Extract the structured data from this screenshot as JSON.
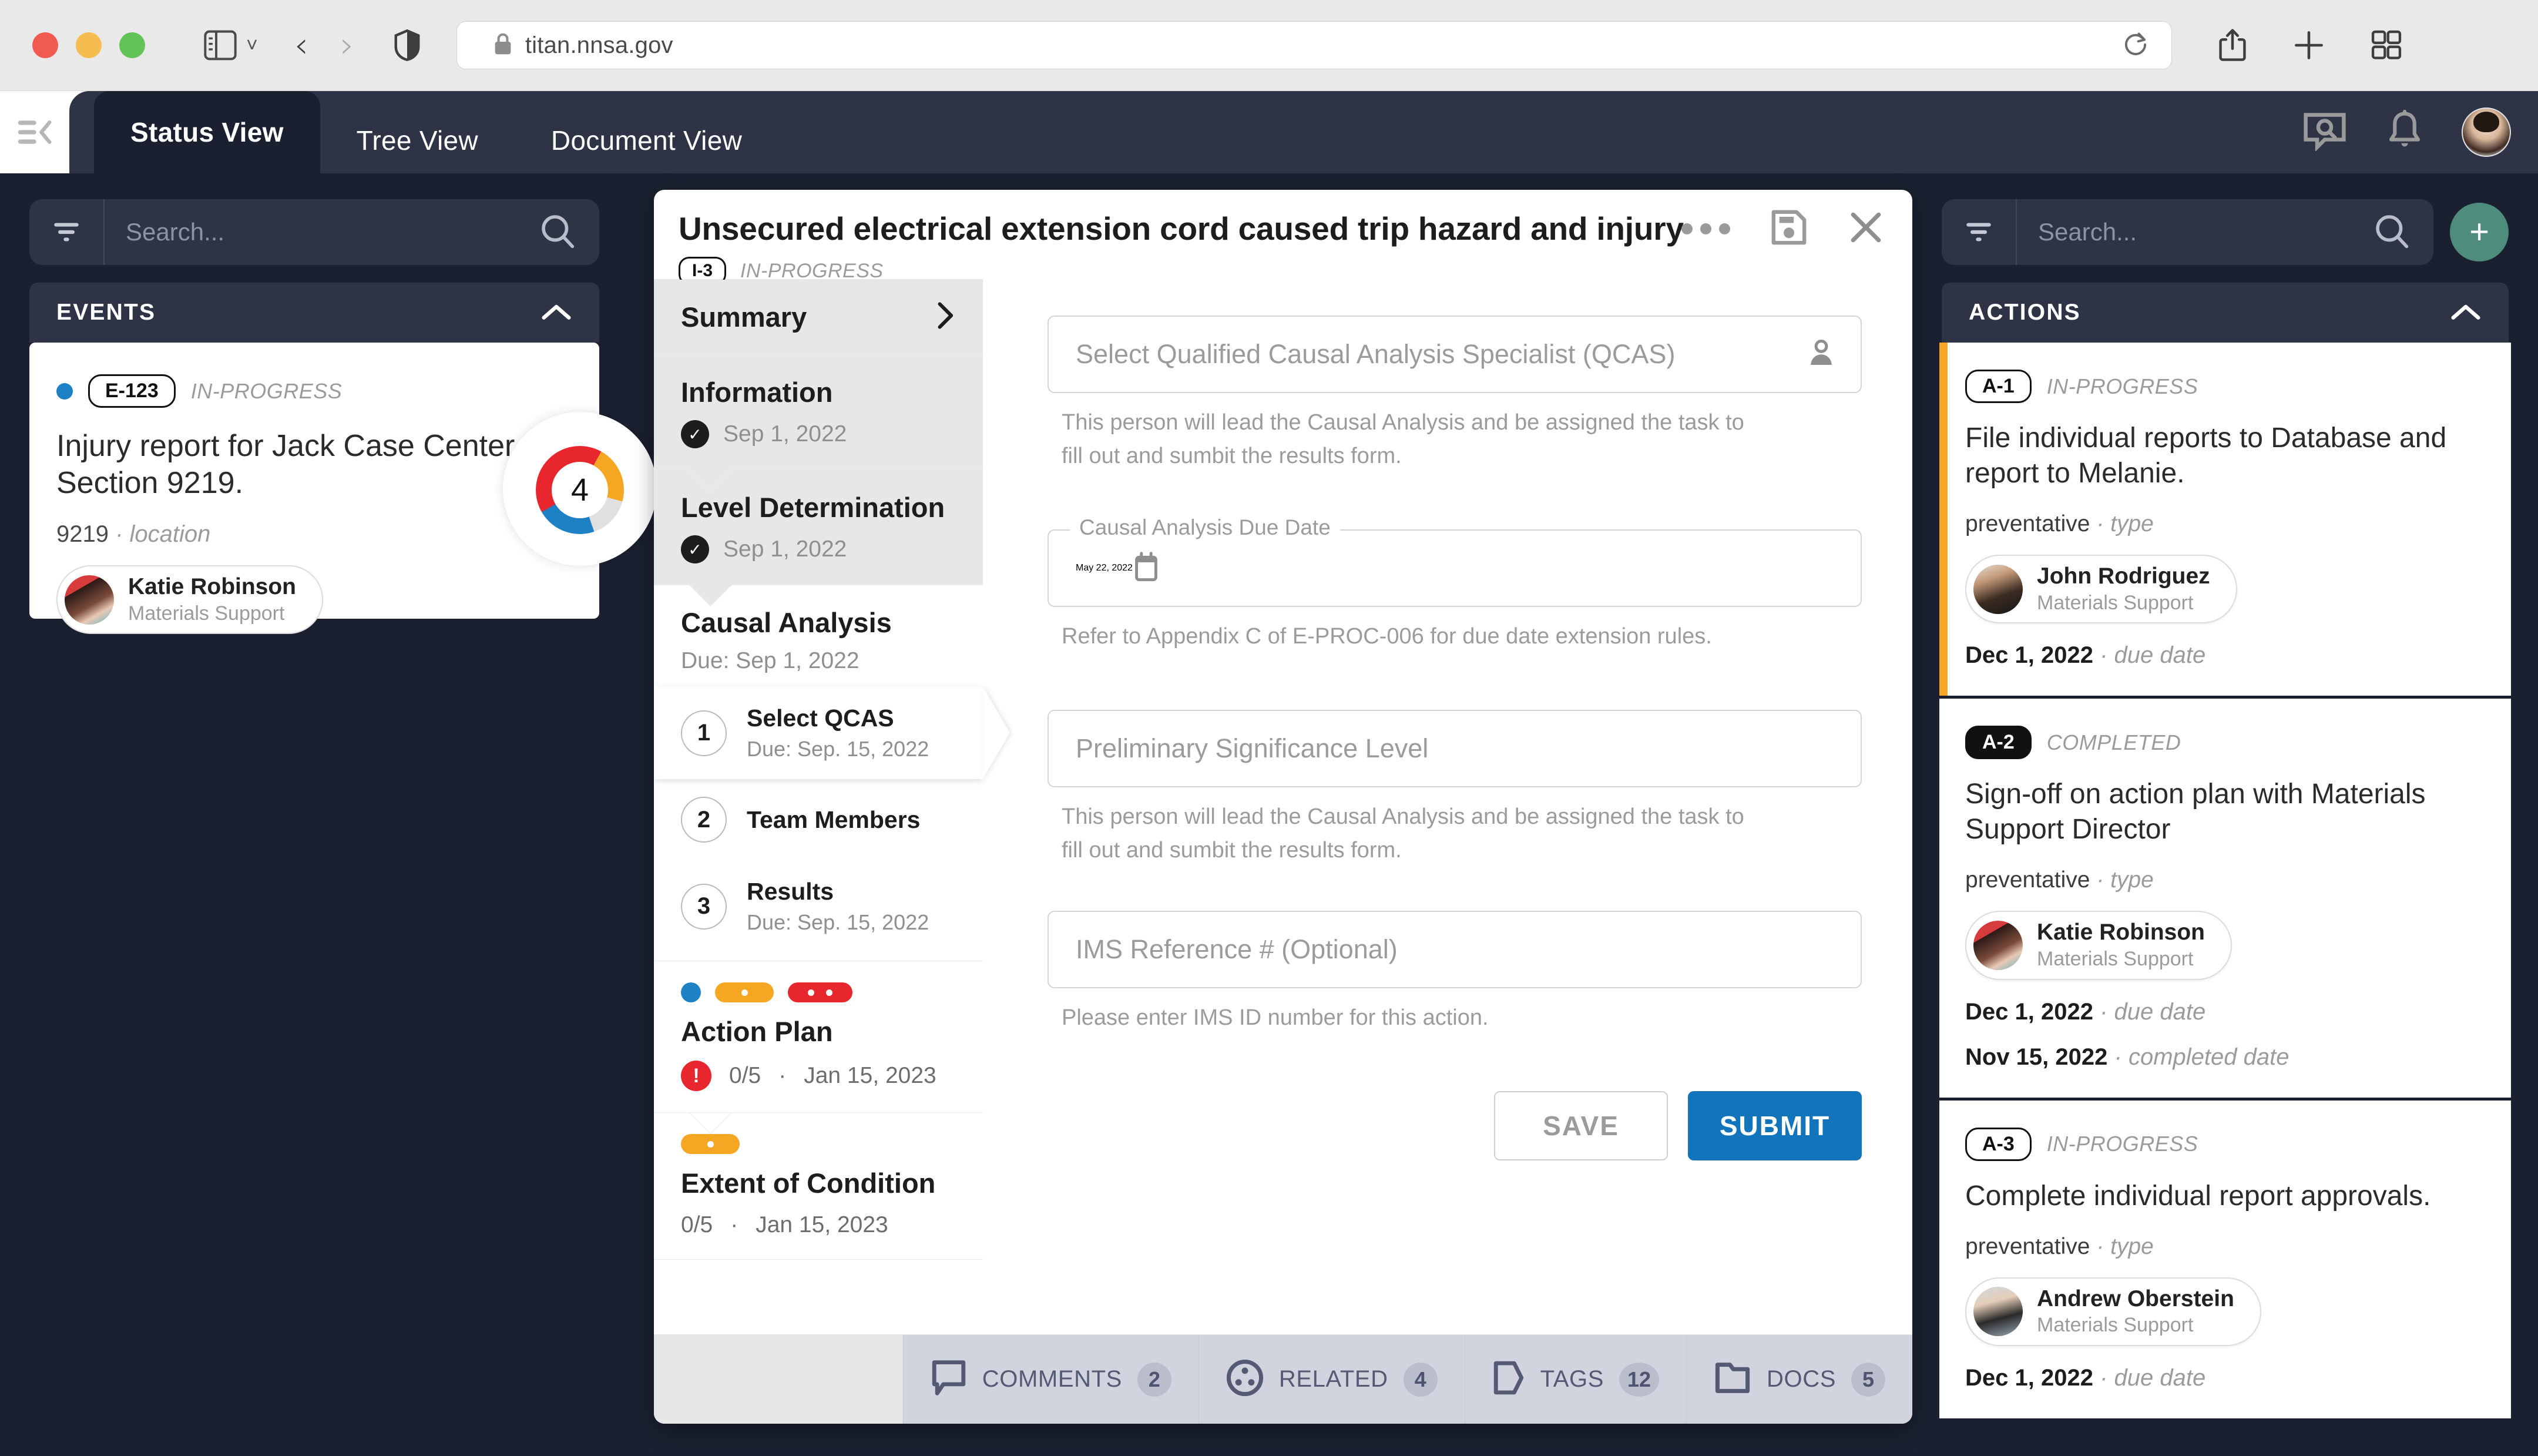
{
  "browser": {
    "url": "titan.nnsa.gov",
    "icons": {
      "sidebar": "sidebar-icon",
      "back": "back-arrow-icon",
      "forward": "forward-arrow-icon",
      "shield": "shield-icon",
      "lock": "lock-icon",
      "reload": "reload-icon",
      "share": "share-icon",
      "new_tab": "plus-icon",
      "tab_overview": "grid-icon"
    }
  },
  "appbar": {
    "tabs": [
      {
        "label": "Status View",
        "active": true
      },
      {
        "label": "Tree View",
        "active": false
      },
      {
        "label": "Document View",
        "active": false
      }
    ]
  },
  "left_panel": {
    "search": {
      "placeholder": "Search..."
    },
    "section": {
      "title": "EVENTS"
    },
    "event": {
      "id": "E-123",
      "status": "IN-PROGRESS",
      "title": "Injury report for Jack Case Center, Section 9219.",
      "number": "9219",
      "number_label": "location",
      "person": {
        "name": "Katie Robinson",
        "role": "Materials Support"
      },
      "donut_value": "4"
    }
  },
  "center": {
    "title": "Unsecured electrical extension cord caused trip  hazard and injury",
    "id": "I-3",
    "status": "IN-PROGRESS",
    "steps": {
      "summary": {
        "label": "Summary"
      },
      "information": {
        "label": "Information",
        "date": "Sep 1, 2022"
      },
      "level_determination": {
        "label": "Level Determination",
        "date": "Sep 1, 2022"
      },
      "causal_analysis": {
        "label": "Causal Analysis",
        "due": "Due: Sep 1, 2022"
      },
      "substeps": [
        {
          "num": "1",
          "label": "Select QCAS",
          "due": "Due: Sep. 15, 2022",
          "active": true
        },
        {
          "num": "2",
          "label": "Team Members",
          "due": "",
          "active": false
        },
        {
          "num": "3",
          "label": "Results",
          "due": "Due: Sep. 15, 2022",
          "active": false
        }
      ],
      "action_plan": {
        "label": "Action Plan",
        "progress": "0/5",
        "date": "Jan 15, 2023"
      },
      "extent_of_condition": {
        "label": "Extent of Condition",
        "progress": "0/5",
        "date": "Jan 15, 2023"
      }
    },
    "form": {
      "qcas": {
        "placeholder": "Select Qualified Causal Analysis Specialist (QCAS)",
        "helper": "This person will lead the Causal Analysis and be assigned the task to fill out and sumbit the results form."
      },
      "due_date": {
        "legend": "Causal Analysis Due Date",
        "value": "May 22, 2022",
        "helper": "Refer to Appendix C of E-PROC-006 for due date extension rules."
      },
      "significance": {
        "placeholder": "Preliminary Significance Level",
        "helper": "This person will lead the Causal Analysis and be assigned the task to fill out and sumbit the results form."
      },
      "ims": {
        "placeholder": "IMS Reference # (Optional)",
        "helper": "Please enter IMS ID number for this action."
      },
      "save_label": "SAVE",
      "submit_label": "SUBMIT"
    },
    "footer_tabs": [
      {
        "label": "COMMENTS",
        "count": "2",
        "icon": "comment-icon"
      },
      {
        "label": "RELATED",
        "count": "4",
        "icon": "related-icon"
      },
      {
        "label": "TAGS",
        "count": "12",
        "icon": "tag-icon"
      },
      {
        "label": "DOCS",
        "count": "5",
        "icon": "folder-icon"
      }
    ]
  },
  "right_panel": {
    "search": {
      "placeholder": "Search..."
    },
    "section": {
      "title": "ACTIONS"
    },
    "actions": [
      {
        "id": "A-1",
        "status": "IN-PROGRESS",
        "title": "File individual reports to Database and report to Melanie.",
        "type": "preventative",
        "type_label": "type",
        "person": {
          "name": "John Rodriguez",
          "role": "Materials Support"
        },
        "due_date": "Dec 1, 2022",
        "due_label": "due date",
        "completed_date": "",
        "completed_label": ""
      },
      {
        "id": "A-2",
        "status": "COMPLETED",
        "title": "Sign-off on action plan with Materials Support Director",
        "type": "preventative",
        "type_label": "type",
        "person": {
          "name": "Katie Robinson",
          "role": "Materials Support"
        },
        "due_date": "Dec 1, 2022",
        "due_label": "due date",
        "completed_date": "Nov 15, 2022",
        "completed_label": "completed date"
      },
      {
        "id": "A-3",
        "status": "IN-PROGRESS",
        "title": "Complete individual report approvals.",
        "type": "preventative",
        "type_label": "type",
        "person": {
          "name": "Andrew Oberstein",
          "role": "Materials Support"
        },
        "due_date": "Dec 1, 2022",
        "due_label": "due date",
        "completed_date": "",
        "completed_label": ""
      }
    ]
  },
  "colors": {
    "accent_blue": "#1275bc",
    "status_blue": "#1e81c6",
    "status_orange": "#f5a623",
    "status_red": "#e8262d",
    "add_green": "#4e8d7c",
    "panel_dark": "#1b2030",
    "panel_dark2": "#2e3346"
  }
}
